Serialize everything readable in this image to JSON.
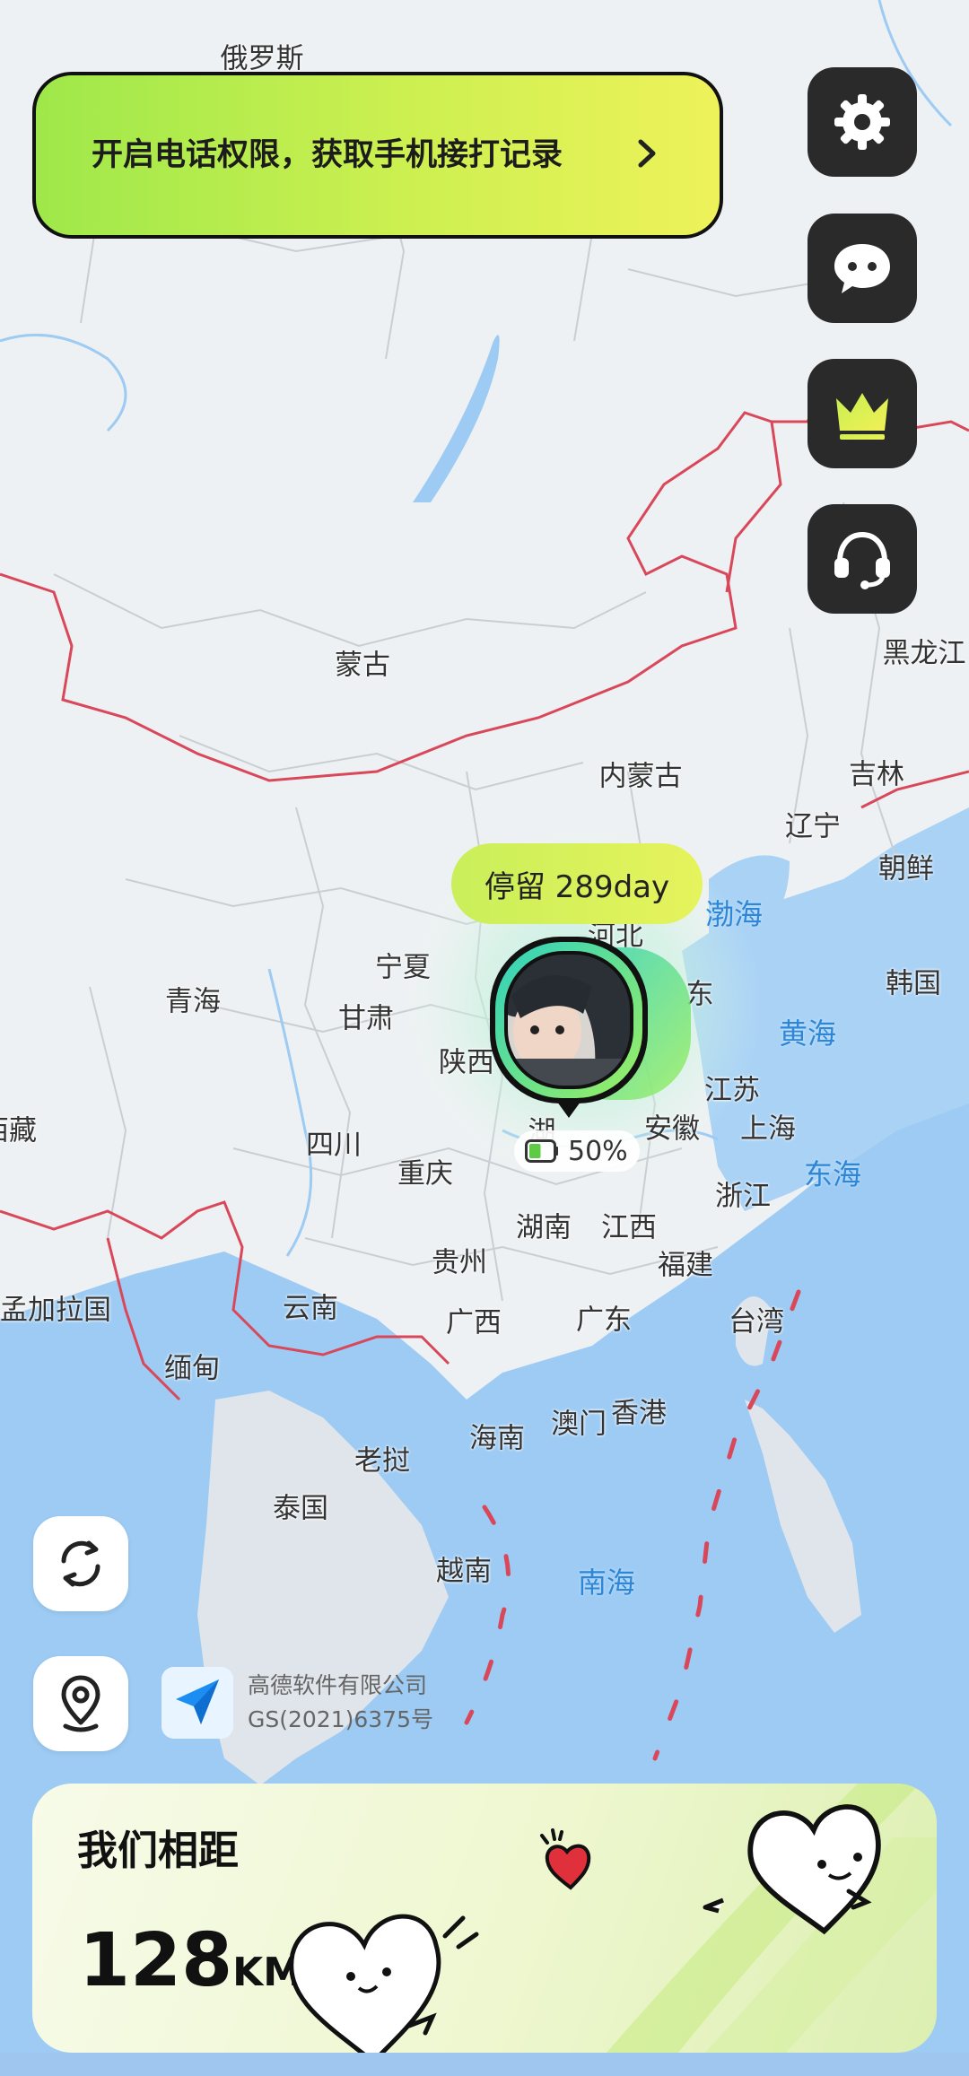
{
  "banner": {
    "text": "开启电话权限，获取手机接打记录"
  },
  "map_labels": {
    "russia": "俄罗斯",
    "mongolia": "蒙古",
    "heilongjiang": "黑龙江",
    "inner_mongolia": "内蒙古",
    "jilin": "吉林",
    "liaoning": "辽宁",
    "north_korea": "朝鲜",
    "south_korea": "韩国",
    "bohai": "渤海",
    "yellow_sea": "黄海",
    "east_sea": "东海",
    "south_sea": "南海",
    "ningxia": "宁夏",
    "qinghai": "青海",
    "gansu": "甘肃",
    "shaanxi": "陕西",
    "hebei": "河北",
    "shandong": "东",
    "jiangsu": "江苏",
    "anhui": "安徽",
    "shanghai": "上海",
    "zhejiang": "浙江",
    "tibet": "西藏",
    "sichuan": "四川",
    "chongqing": "重庆",
    "hubei": "湖",
    "hunan": "湖南",
    "jiangxi": "江西",
    "fujian": "福建",
    "guizhou": "贵州",
    "taiwan": "台湾",
    "bangladesh": "孟加拉国",
    "yunnan": "云南",
    "guangxi": "广西",
    "guangdong": "广东",
    "myanmar": "缅甸",
    "macau": "澳门",
    "hongkong": "香港",
    "hainan": "海南",
    "laos": "老挝",
    "thailand": "泰国",
    "vietnam": "越南"
  },
  "stay": {
    "text": "停留 289day"
  },
  "battery": {
    "percent_text": "50%",
    "level": 0.5
  },
  "attribution": {
    "line1": "高德软件有限公司",
    "line2": "GS(2021)6375号"
  },
  "distance": {
    "title": "我们相距",
    "value": "128",
    "unit": "KM"
  },
  "colors": {
    "accent": "#c9ef5a",
    "dark_button": "#2a2a2a",
    "border_red": "#d9485a",
    "sea": "#9dcbf3"
  },
  "icons": {
    "settings": "gear-icon",
    "chat": "chat-bubble-icon",
    "vip": "crown-icon",
    "support": "headset-icon",
    "refresh": "refresh-icon",
    "location": "location-pin-icon",
    "map_logo": "amap-logo-icon"
  }
}
